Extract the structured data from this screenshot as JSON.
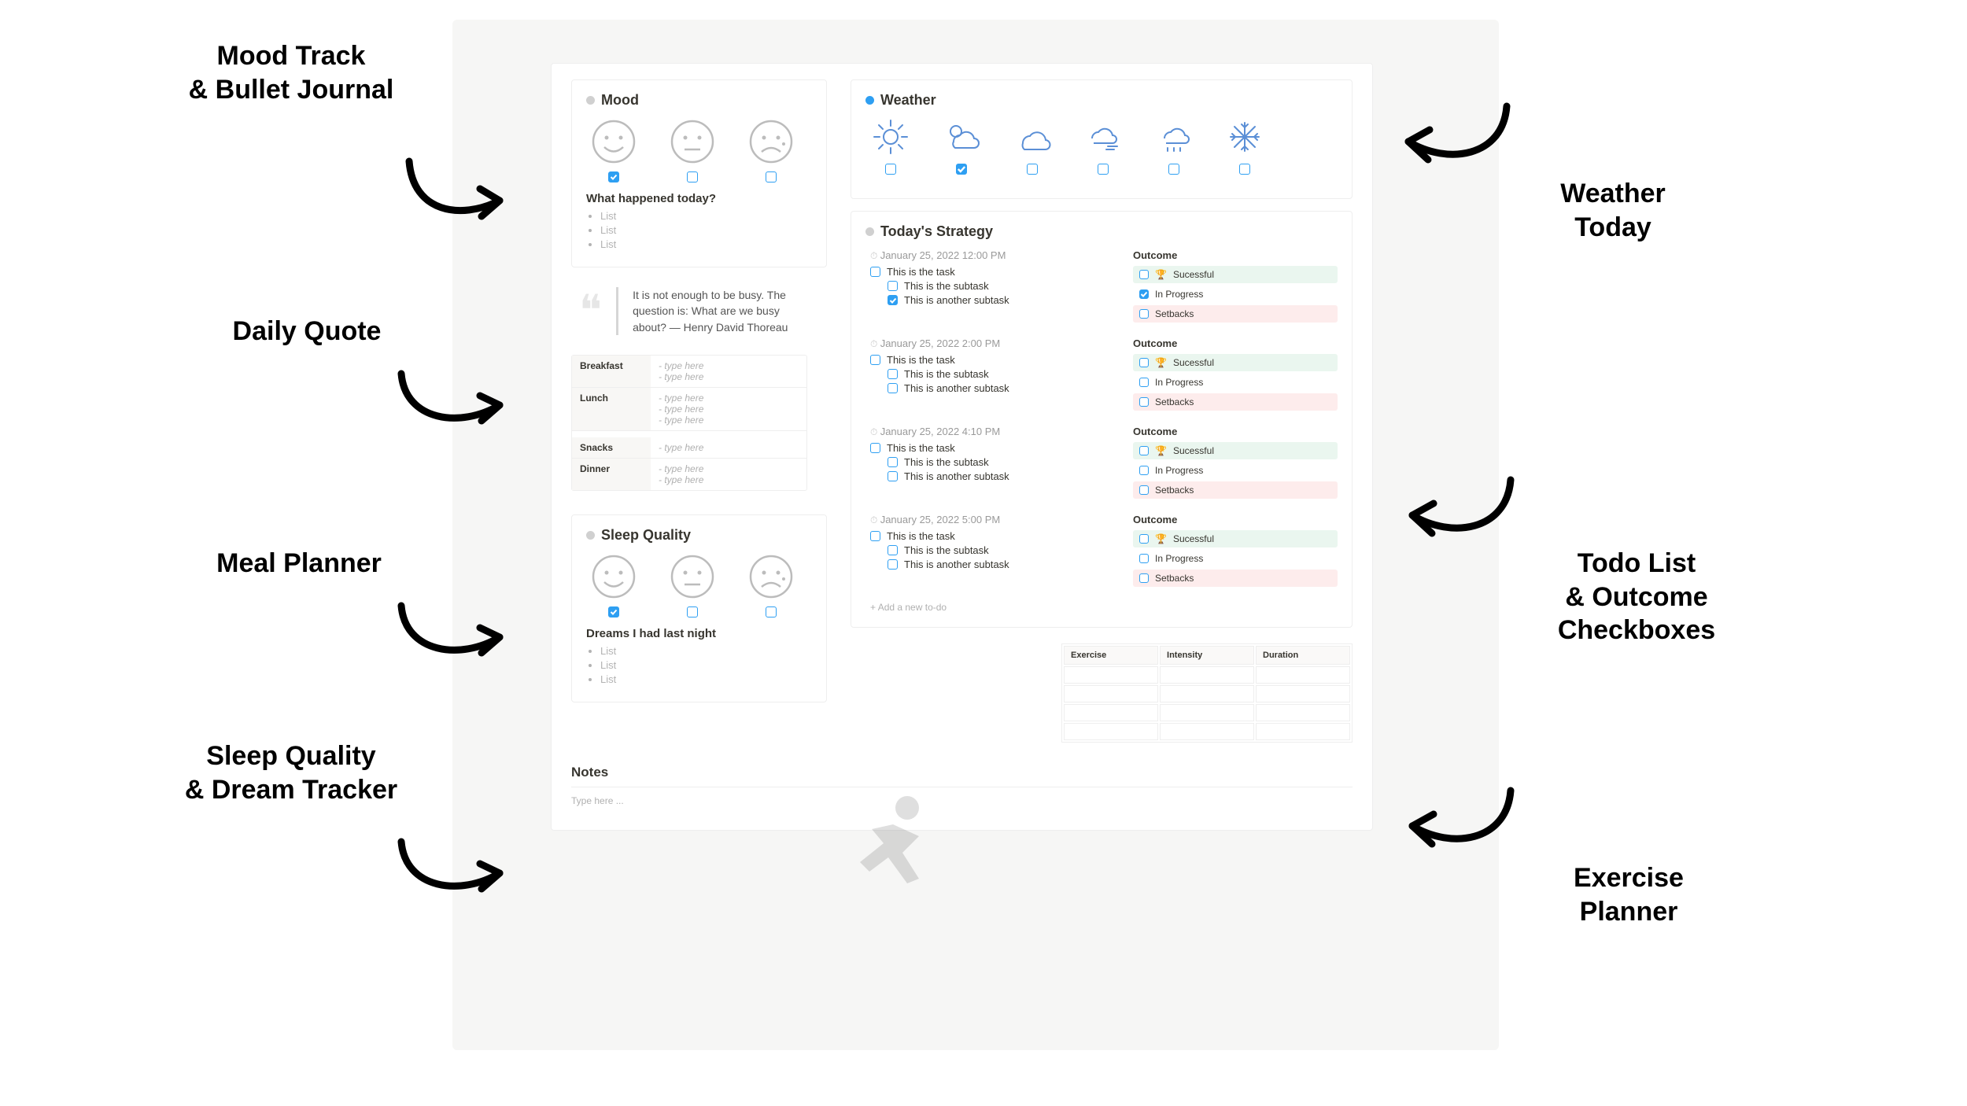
{
  "labels": {
    "mood": "Mood Track\n& Bullet Journal",
    "quote": "Daily Quote",
    "meal": "Meal Planner",
    "sleep": "Sleep Quality\n& Dream Tracker",
    "weather": "Weather\nToday",
    "todo": "Todo List\n& Outcome\nCheckboxes",
    "exercise": "Exercise\nPlanner"
  },
  "mood": {
    "title": "Mood",
    "faces": [
      {
        "name": "happy",
        "checked": true
      },
      {
        "name": "neutral",
        "checked": false
      },
      {
        "name": "sad",
        "checked": false
      }
    ],
    "journal_title": "What happened today?",
    "journal_items": [
      "List",
      "List",
      "List"
    ]
  },
  "weather": {
    "title": "Weather",
    "options": [
      {
        "name": "sunny",
        "checked": false
      },
      {
        "name": "partly-cloudy",
        "checked": true
      },
      {
        "name": "cloudy",
        "checked": false
      },
      {
        "name": "windy",
        "checked": false
      },
      {
        "name": "rainy",
        "checked": false
      },
      {
        "name": "snowy",
        "checked": false
      }
    ]
  },
  "quote": {
    "text": "It is not enough to be busy. The question is: What are we busy about? — Henry David Thoreau"
  },
  "meals": {
    "rows": [
      {
        "label": "Breakfast",
        "lines": [
          "- type here",
          "- type here"
        ]
      },
      {
        "label": "Lunch",
        "lines": [
          "- type here",
          "- type here",
          "- type here"
        ]
      },
      {
        "label": "Snacks",
        "lines": [
          "- type here"
        ],
        "gap": true
      },
      {
        "label": "Dinner",
        "lines": [
          "- type here",
          "- type here"
        ]
      }
    ]
  },
  "sleep": {
    "title": "Sleep Quality",
    "faces": [
      {
        "name": "happy",
        "checked": true
      },
      {
        "name": "neutral",
        "checked": false
      },
      {
        "name": "sad",
        "checked": false
      }
    ],
    "dreams_title": "Dreams I had last night",
    "dream_items": [
      "List",
      "List",
      "List"
    ]
  },
  "strategy": {
    "title": "Today's Strategy",
    "outcome_label": "Outcome",
    "outcomes": [
      {
        "label": "Sucessful",
        "cls": "out-succ",
        "trophy": true
      },
      {
        "label": "In Progress",
        "cls": "out-prog",
        "trophy": false
      },
      {
        "label": "Setbacks",
        "cls": "out-setb",
        "trophy": false
      }
    ],
    "slots": [
      {
        "time": "January 25, 2022 12:00 PM",
        "tasks": [
          {
            "text": "This is the task",
            "checked": false,
            "sub": false
          },
          {
            "text": "This is the subtask",
            "checked": false,
            "sub": true
          },
          {
            "text": "This is another subtask",
            "checked": true,
            "sub": true
          }
        ],
        "outcome_checked_index": 1
      },
      {
        "time": "January 25, 2022 2:00 PM",
        "tasks": [
          {
            "text": "This is the task",
            "checked": false,
            "sub": false
          },
          {
            "text": "This is the subtask",
            "checked": false,
            "sub": true
          },
          {
            "text": "This is another subtask",
            "checked": false,
            "sub": true
          }
        ],
        "outcome_checked_index": -1
      },
      {
        "time": "January 25, 2022 4:10 PM",
        "tasks": [
          {
            "text": "This is the task",
            "checked": false,
            "sub": false
          },
          {
            "text": "This is the subtask",
            "checked": false,
            "sub": true
          },
          {
            "text": "This is another subtask",
            "checked": false,
            "sub": true
          }
        ],
        "outcome_checked_index": -1
      },
      {
        "time": "January 25, 2022 5:00 PM",
        "tasks": [
          {
            "text": "This is the task",
            "checked": false,
            "sub": false
          },
          {
            "text": "This is the subtask",
            "checked": false,
            "sub": true
          },
          {
            "text": "This is another subtask",
            "checked": false,
            "sub": true
          }
        ],
        "outcome_checked_index": -1
      }
    ],
    "add_new": "Add a new to-do"
  },
  "exercise": {
    "headers": [
      "Exercise",
      "Intensity",
      "Duration"
    ],
    "rows": 4
  },
  "notes": {
    "title": "Notes",
    "placeholder": "Type here ..."
  }
}
